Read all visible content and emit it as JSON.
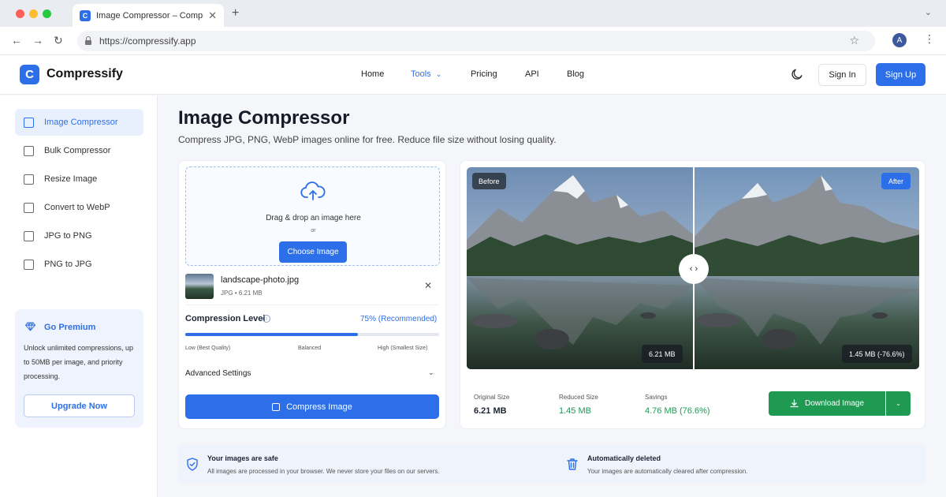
{
  "browser": {
    "tab_title": "Image Compressor – Compressify",
    "favicon_letter": "C",
    "new_tab": "+",
    "url": "https://compressify.app",
    "profile_initial": "A"
  },
  "header": {
    "logo_letter": "C",
    "brand": "Compressify",
    "nav": [
      "Home",
      "Tools",
      "Pricing",
      "API",
      "Blog"
    ],
    "active_nav": "Tools",
    "sign_in": "Sign In",
    "sign_up": "Sign Up"
  },
  "sidebar": {
    "items": [
      "Image Compressor",
      "Bulk Compressor",
      "Resize Image",
      "Convert to WebP",
      "JPG to PNG",
      "PNG to JPG"
    ],
    "active": "Image Compressor",
    "premium": {
      "title": "Go Premium",
      "text": "Unlock unlimited compressions, up to 50MB per image, and priority processing.",
      "button": "Upgrade Now"
    }
  },
  "main": {
    "title": "Image Compressor",
    "subtitle": "Compress JPG, PNG, WebP images online for free. Reduce file size without losing quality."
  },
  "upload": {
    "drop_text": "Drag & drop an image here",
    "or": "or",
    "choose_button": "Choose Image",
    "file_name": "landscape-photo.jpg",
    "file_meta": "JPG • 6.21 MB",
    "compression_label": "Compression Level",
    "compression_value": "75% (Recommended)",
    "compression_percent": 0.68,
    "scale_low": "Low (Best Quality)",
    "scale_mid": "Balanced",
    "scale_high": "High (Smallest Size)",
    "advanced": "Advanced Settings",
    "compress_button": "Compress Image"
  },
  "preview": {
    "before_tag": "Before",
    "after_tag": "After",
    "before_size": "6.21 MB",
    "after_size": "1.45 MB (-76.6%)",
    "stats": [
      {
        "label": "Original Size",
        "value": "6.21 MB"
      },
      {
        "label": "Reduced Size",
        "value": "1.45 MB"
      },
      {
        "label": "Savings",
        "value": "4.76 MB (76.6%)"
      }
    ],
    "download_button": "Download Image"
  },
  "safety": [
    {
      "title": "Your images are safe",
      "text": "All images are processed in your browser. We never store your files on our servers."
    },
    {
      "title": "Automatically deleted",
      "text": "Your images are automatically cleared after compression."
    }
  ],
  "colors": {
    "accent": "#2d6fe8",
    "success": "#1f9a53"
  }
}
